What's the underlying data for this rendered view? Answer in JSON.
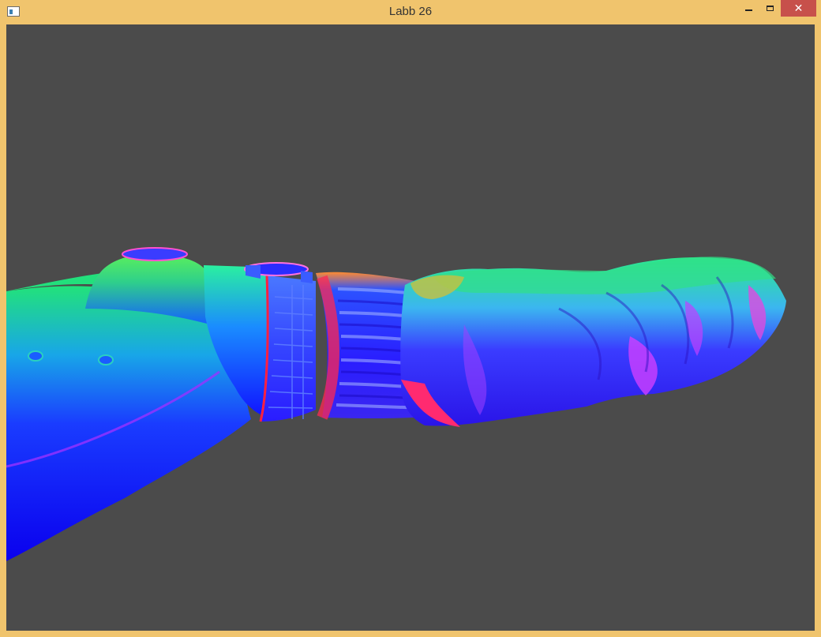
{
  "window": {
    "title": "Labb 26",
    "controls": {
      "minimize_icon": "minimize-icon",
      "maximize_icon": "maximize-icon",
      "close_icon": "close-icon",
      "close_glyph": "✕"
    },
    "frame_color": "#f0c46d",
    "close_color": "#c7504b"
  },
  "viewport": {
    "background_color": "#4b4b4b",
    "content": "3d-render-normal-shaded-arm"
  }
}
